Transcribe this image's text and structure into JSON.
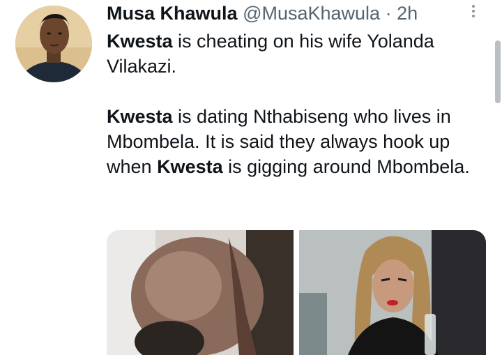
{
  "tweet": {
    "author_name": "Musa Khawula",
    "author_handle": "@MusaKhawula",
    "separator": "·",
    "time": "2h",
    "paragraph1": {
      "bold": "Kwesta",
      "rest_line1": " is cheating on his wife Yolanda",
      "rest_line2": "Vilakazi."
    },
    "paragraph2": {
      "bold1": "Kwesta",
      "text1": " is dating Nthabiseng who lives in Mbombela. It is said they always hook up when ",
      "bold2": "Kwesta",
      "text2": " is gigging around Mbombela."
    }
  },
  "icons": {
    "more": "more-vertical-icon"
  }
}
